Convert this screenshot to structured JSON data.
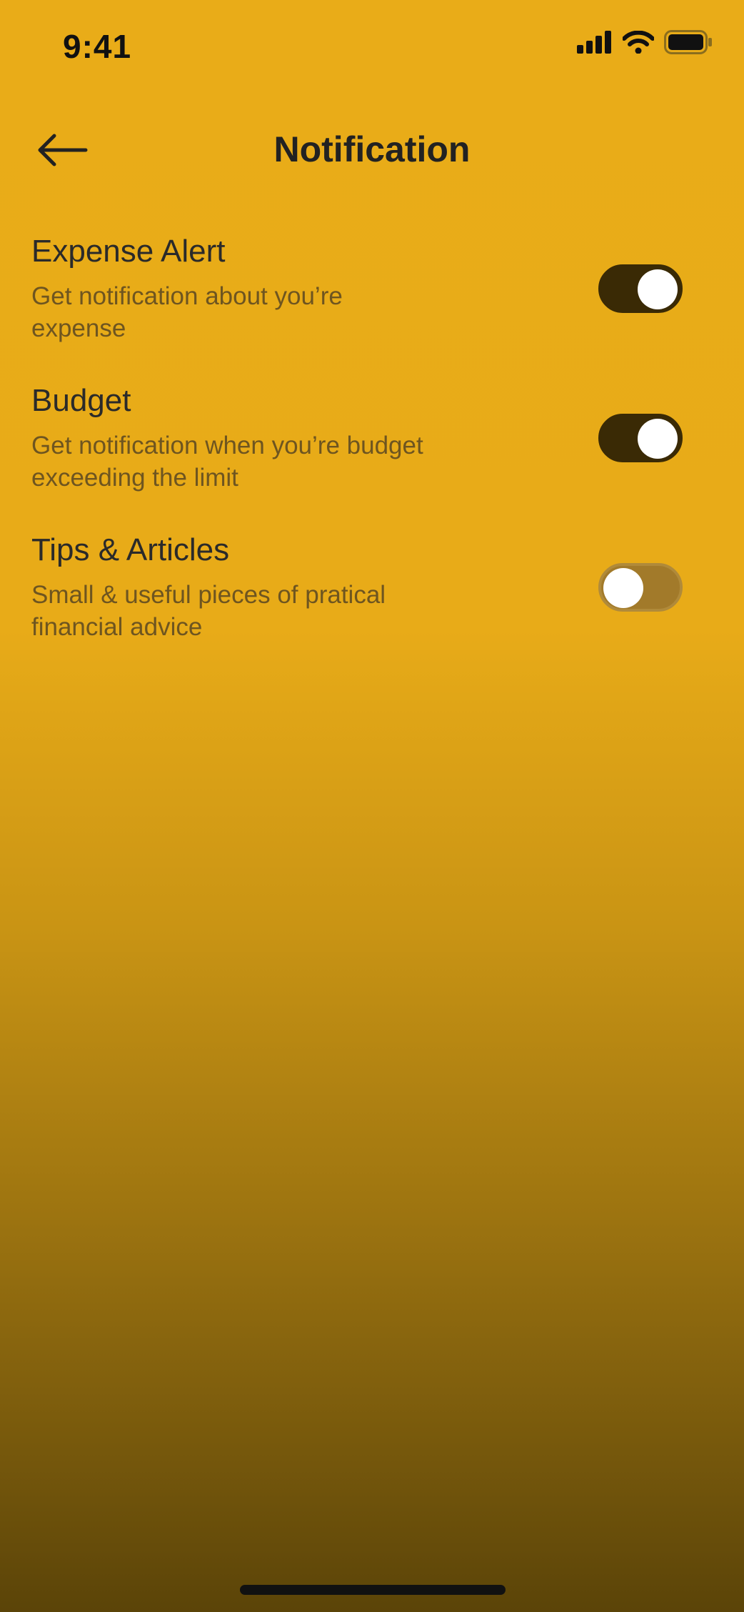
{
  "status_bar": {
    "time": "9:41",
    "icons": [
      "signal-icon",
      "wifi-icon",
      "battery-icon"
    ]
  },
  "header": {
    "back_icon": "arrow-left-icon",
    "title": "Notification"
  },
  "settings": [
    {
      "title": "Expense Alert",
      "description": "Get notification about you’re expense",
      "enabled": true
    },
    {
      "title": "Budget",
      "description": "Get notification when you’re budget exceeding the limit",
      "enabled": true
    },
    {
      "title": "Tips & Articles",
      "description": "Small & useful pieces of pratical financial advice",
      "enabled": false
    }
  ],
  "colors": {
    "background_top": "#E9AC18",
    "background_bottom": "#5B4408",
    "toggle_on": "#3A2A05",
    "toggle_off": "#A27A2A"
  }
}
